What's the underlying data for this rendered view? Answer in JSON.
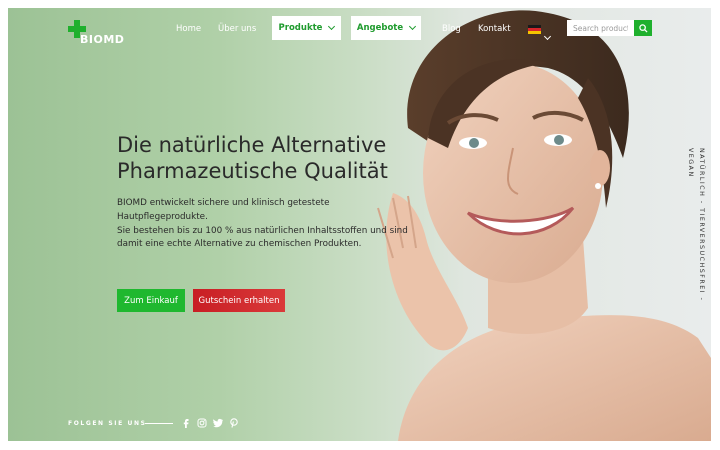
{
  "header": {
    "logo_text": "BIOMD",
    "nav": {
      "home": "Home",
      "about": "Über uns",
      "products": "Produkte",
      "offers": "Angebote",
      "blog": "Blog",
      "contact": "Kontakt"
    },
    "language_flag": "de-flag-icon",
    "search": {
      "placeholder": "Search products"
    }
  },
  "hero": {
    "headline_line1": "Die natürliche Alternative",
    "headline_line2": "Pharmazeutische Qualität",
    "paragraph_line1": "BIOMD entwickelt sichere und klinisch getestete",
    "paragraph_line2": "Hautpflegeprodukte.",
    "paragraph_line3": "Sie bestehen bis zu 100 % aus natürlichen Inhaltsstoffen und sind",
    "paragraph_line4": "damit eine echte Alternative zu chemischen Produkten.",
    "btn_shop": "Zum Einkauf",
    "btn_voucher": "Gutschein erhalten",
    "tagline": "NATÜRLICH - TIERVERSUCHSFREI - VEGAN"
  },
  "footer": {
    "follow_label": "FOLGEN SIE UNS",
    "social": [
      "facebook-icon",
      "instagram-icon",
      "twitter-icon",
      "pinterest-icon"
    ]
  },
  "colors": {
    "accent_green": "#1fb02d",
    "voucher_red": "#d02a2f",
    "hero_bg_green": "#a9cba1"
  }
}
